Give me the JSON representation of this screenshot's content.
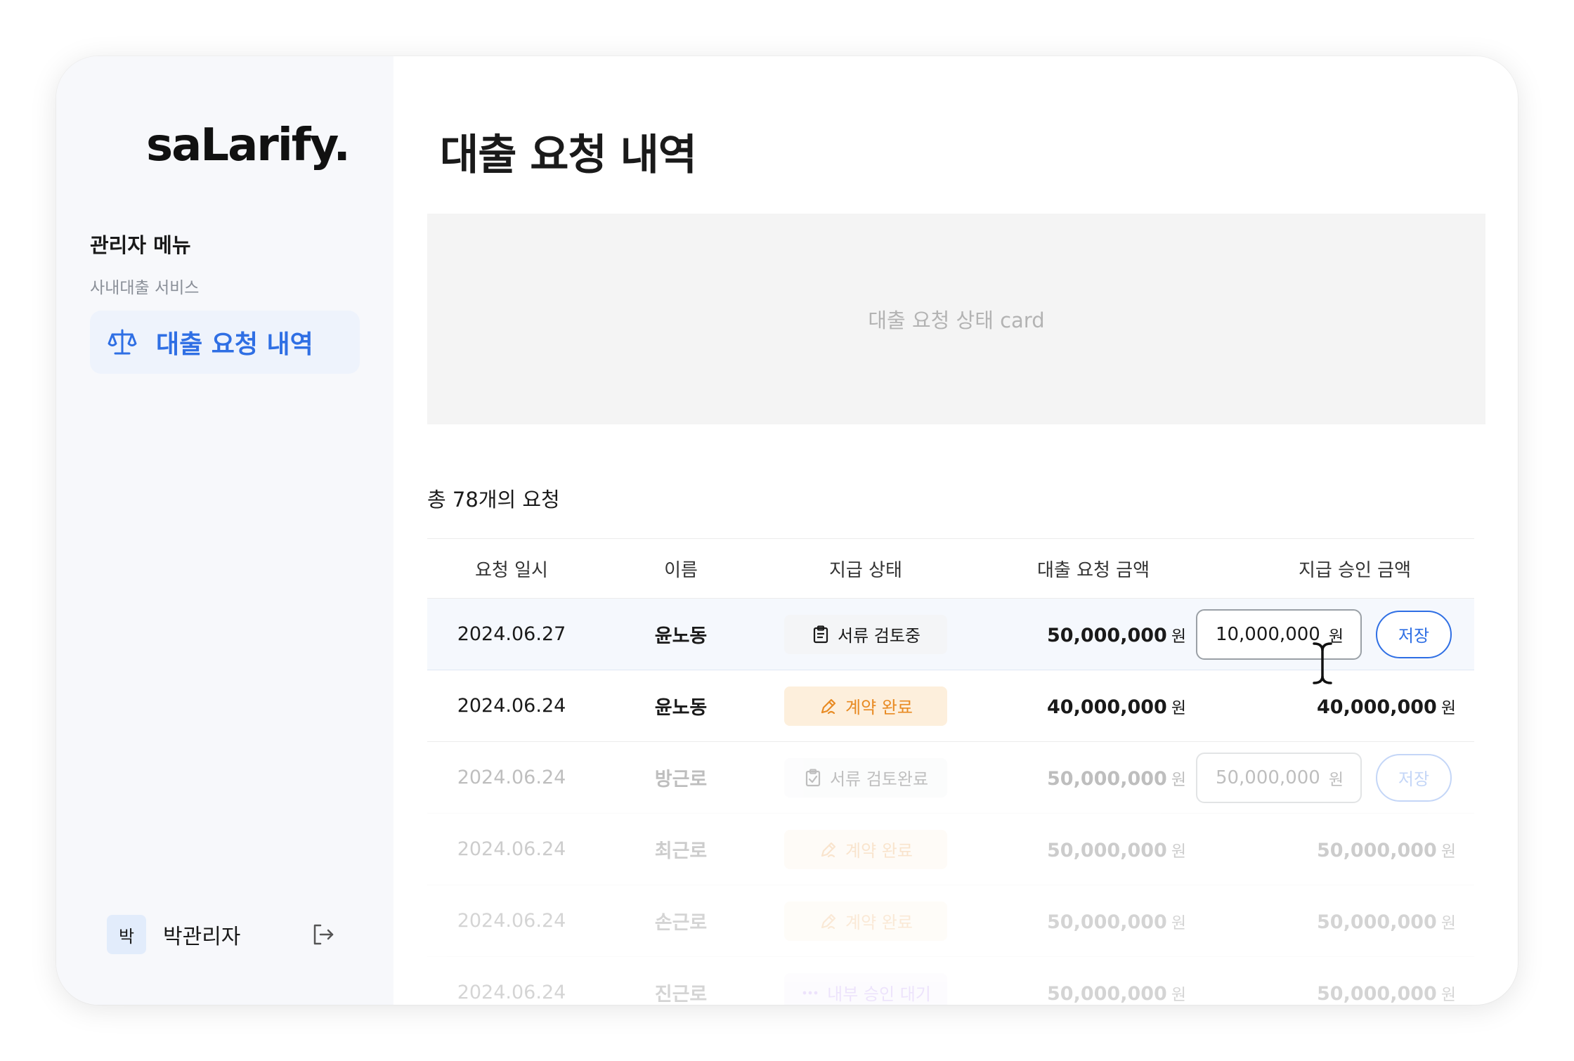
{
  "brand": {
    "logo": "saLarify.",
    "accent": "#2f6fe4"
  },
  "sidebar": {
    "menu_title": "관리자 메뉴",
    "section": "사내대출 서비스",
    "active_item": {
      "label": "대출 요청 내역",
      "icon": "scale-icon"
    },
    "user": {
      "avatar_text": "박",
      "name": "박관리자"
    },
    "logout_icon": "logout-icon"
  },
  "main": {
    "title": "대출 요청 내역",
    "card_placeholder": "대출 요청 상태 card",
    "count_text": "총 78개의 요청"
  },
  "table": {
    "headers": [
      "요청 일시",
      "이름",
      "지급 상태",
      "대출 요청 금액",
      "지급 승인 금액"
    ],
    "currency": "원",
    "save_label": "저장",
    "rows": [
      {
        "date": "2024.06.27",
        "name": "윤노동",
        "status": "서류 검토중",
        "status_type": "review",
        "requested": "50,000,000",
        "approved": "10,000,000",
        "editable": true
      },
      {
        "date": "2024.06.24",
        "name": "윤노동",
        "status": "계약 완료",
        "status_type": "contract",
        "requested": "40,000,000",
        "approved": "40,000,000",
        "editable": false
      },
      {
        "date": "2024.06.24",
        "name": "방근로",
        "status": "서류 검토완료",
        "status_type": "reviewed",
        "requested": "50,000,000",
        "approved": "50,000,000",
        "editable": true
      },
      {
        "date": "2024.06.24",
        "name": "최근로",
        "status": "계약 완료",
        "status_type": "contract",
        "requested": "50,000,000",
        "approved": "50,000,000",
        "editable": false
      },
      {
        "date": "2024.06.24",
        "name": "손근로",
        "status": "계약 완료",
        "status_type": "contract",
        "requested": "50,000,000",
        "approved": "50,000,000",
        "editable": false
      },
      {
        "date": "2024.06.24",
        "name": "진근로",
        "status": "내부 승인 대기",
        "status_type": "internal",
        "requested": "50,000,000",
        "approved": "50,000,000",
        "editable": false
      }
    ]
  }
}
